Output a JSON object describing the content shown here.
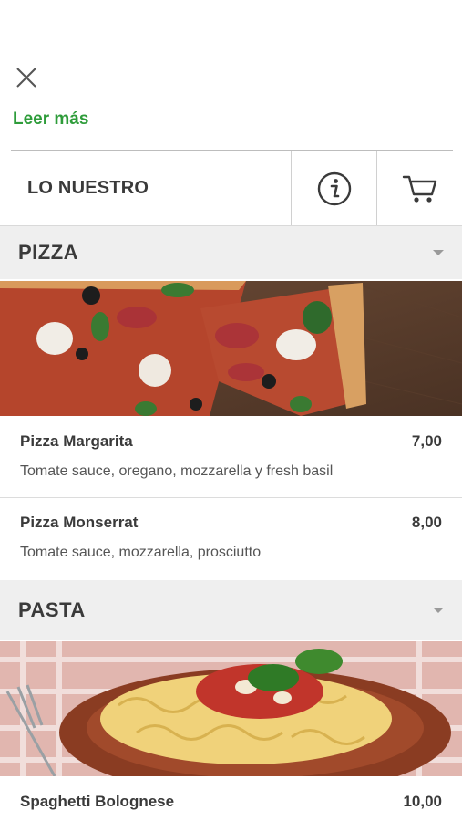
{
  "header": {
    "read_more": "Leer más"
  },
  "tabs": {
    "main_label": "LO NUESTRO",
    "info_icon": "info-icon",
    "cart_icon": "cart-icon"
  },
  "sections": [
    {
      "title": "PIZZA",
      "items": [
        {
          "name": "Pizza Margarita",
          "price": "7,00",
          "description": "Tomate sauce, oregano, mozzarella y fresh basil"
        },
        {
          "name": "Pizza Monserrat",
          "price": "8,00",
          "description": "Tomate sauce, mozzarella, prosciutto"
        }
      ]
    },
    {
      "title": "PASTA",
      "items": [
        {
          "name": "Spaghetti Bolognese",
          "price": "10,00"
        }
      ]
    }
  ],
  "colors": {
    "accent": "#2e9c3a",
    "section_bg": "#efefef"
  }
}
